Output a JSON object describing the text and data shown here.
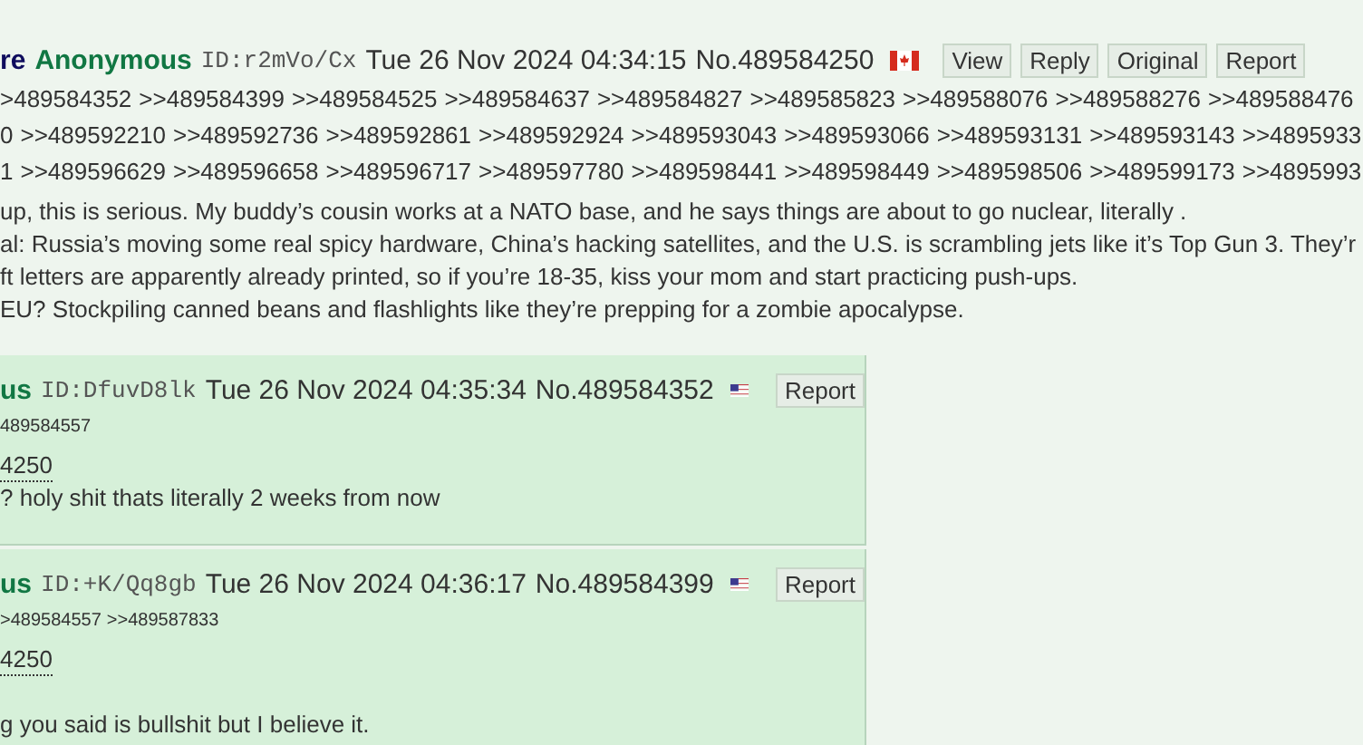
{
  "op": {
    "subject": "re",
    "name": "Anonymous",
    "id": "ID:r2mVo/Cx",
    "datetime": "Tue 26 Nov 2024 04:34:15",
    "number": "No.489584250",
    "flag": {
      "kind": "ca"
    },
    "buttons": [
      "View",
      "Reply",
      "Original",
      "Report"
    ],
    "backlink_lines": [
      [
        ">489584352",
        ">>489584399",
        ">>489584525",
        ">>489584637",
        ">>489584827",
        ">>489585823",
        ">>489588076",
        ">>489588276",
        ">>489588476"
      ],
      [
        "0",
        ">>489592210",
        ">>489592736",
        ">>489592861",
        ">>489592924",
        ">>489593043",
        ">>489593066",
        ">>489593131",
        ">>489593143",
        ">>4895933"
      ],
      [
        "1",
        ">>489596629",
        ">>489596658",
        ">>489596717",
        ">>489597780",
        ">>489598441",
        ">>489598449",
        ">>489598506",
        ">>489599173",
        ">>4895993"
      ]
    ],
    "body_lines": [
      "up, this is serious. My buddy’s cousin works at a NATO base, and he says things are about to go nuclear, literally .",
      "al: Russia’s moving some real spicy hardware, China’s hacking satellites, and the U.S. is scrambling jets like it’s Top Gun 3. They’r",
      "ft letters are apparently already printed, so if you’re 18-35, kiss your mom and start practicing push-ups.",
      "EU? Stockpiling canned beans and flashlights like they’re prepping for a zombie apocalypse."
    ]
  },
  "replies": [
    {
      "name": "us",
      "id": "ID:DfuvD8lk",
      "datetime": "Tue 26 Nov 2024 04:35:34",
      "number": "No.489584352",
      "flag": {
        "kind": "us"
      },
      "buttons": [
        "Report"
      ],
      "backlinks": [
        "489584557"
      ],
      "quote": "4250",
      "blank_after_quote": false,
      "body_lines": [
        "? holy shit thats literally 2 weeks from now"
      ]
    },
    {
      "name": "us",
      "id": "ID:+K/Qq8gb",
      "datetime": "Tue 26 Nov 2024 04:36:17",
      "number": "No.489584399",
      "flag": {
        "kind": "us"
      },
      "buttons": [
        "Report"
      ],
      "backlinks": [
        ">489584557",
        ">>489587833"
      ],
      "quote": "4250",
      "blank_after_quote": true,
      "body_lines": [
        "g you said is bullshit but I believe it."
      ]
    }
  ]
}
